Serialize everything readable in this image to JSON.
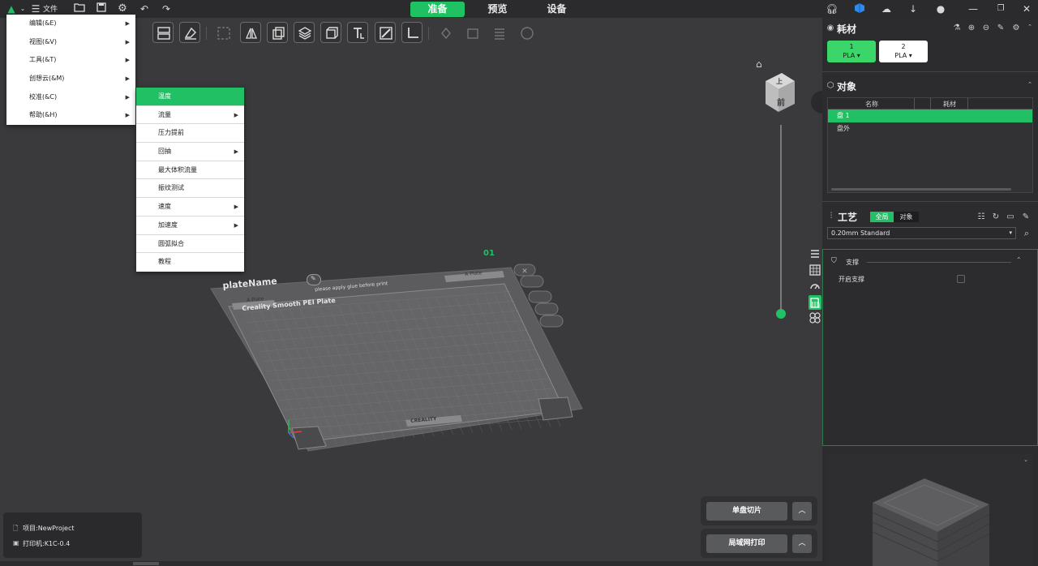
{
  "topbar": {
    "file_label": "文件",
    "tabs": [
      {
        "label": "准备",
        "active": true
      },
      {
        "label": "预览",
        "active": false
      },
      {
        "label": "设备",
        "active": false
      }
    ]
  },
  "main_menu": [
    {
      "label": "编辑(&E)"
    },
    {
      "label": "视图(&V)"
    },
    {
      "label": "工具(&T)"
    },
    {
      "label": "创想云(&M)"
    },
    {
      "label": "校准(&C)"
    },
    {
      "label": "帮助(&H)"
    }
  ],
  "calibration_menu": [
    {
      "label": "温度",
      "submenu": false
    },
    {
      "label": "流量",
      "submenu": true
    },
    {
      "label": "压力提前",
      "submenu": false
    },
    {
      "label": "回抽",
      "submenu": true
    },
    {
      "label": "最大体积流量",
      "submenu": false
    },
    {
      "label": "振纹测试",
      "submenu": false
    },
    {
      "label": "速度",
      "submenu": true
    },
    {
      "label": "加速度",
      "submenu": true
    },
    {
      "label": "圆弧拟合",
      "submenu": false
    },
    {
      "label": "教程",
      "submenu": false
    }
  ],
  "plate": {
    "index": "01",
    "name": "plateName",
    "tag_left": "A Plate",
    "tag_right": "A Plate",
    "notice": "please apply glue before print",
    "surface": "Creality Smooth PEI Plate",
    "brand": "CREALITY"
  },
  "view_cube": {
    "top": "上",
    "front": "前"
  },
  "filament": {
    "title": "耗材",
    "slots": [
      {
        "index": "1",
        "type": "PLA",
        "color": "#3ad66a"
      },
      {
        "index": "2",
        "type": "PLA",
        "color": "#ffffff"
      }
    ]
  },
  "objects": {
    "title": "对象",
    "columns": [
      "名称",
      "耗材"
    ],
    "rows": [
      {
        "name": "盘 1",
        "selected": true
      },
      {
        "name": "盘外",
        "selected": false
      }
    ]
  },
  "process": {
    "title": "工艺",
    "toggle_global": "全局",
    "toggle_object": "对象",
    "preset": "0.20mm Standard",
    "section": "支撑",
    "option_label": "开启支撑"
  },
  "actions": {
    "slice_label": "单盘切片",
    "print_label": "局域网打印"
  },
  "project": {
    "project_label": "项目:NewProject",
    "printer_label": "打印机:K1C-0.4"
  },
  "colors": {
    "accent": "#21c064",
    "background": "#3a3a3c",
    "panel": "#2c2c2e"
  }
}
